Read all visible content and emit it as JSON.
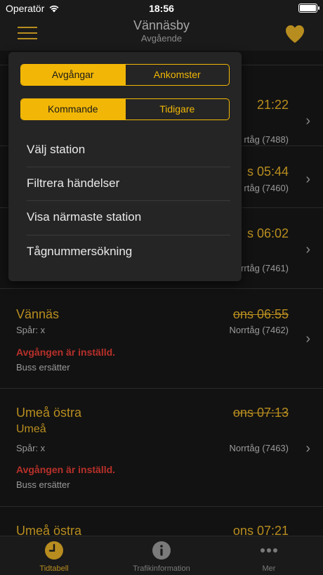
{
  "status_bar": {
    "carrier": "Operatör",
    "time": "18:56"
  },
  "nav": {
    "title": "Vännäsby",
    "subtitle": "Avgående"
  },
  "menu": {
    "seg1": [
      "Avgångar",
      "Ankomster"
    ],
    "seg2": [
      "Kommande",
      "Tidigare"
    ],
    "items": [
      "Välj station",
      "Filtrera händelser",
      "Visa närmaste station",
      "Tågnummersökning"
    ]
  },
  "list": {
    "row1": {
      "time": "21:22",
      "train": "rtåg (7488)"
    },
    "row2": {
      "time": "s 05:44",
      "train": "rtåg (7460)"
    },
    "row3": {
      "time": "s 06:02",
      "train": "rrtåg (7461)"
    },
    "row4": {
      "dest": "Vännäs",
      "time": "ons 06:55",
      "track": "Spår: x",
      "train": "Norrtåg (7462)",
      "cancel": "Avgången är inställd.",
      "bus": "Buss ersätter"
    },
    "row5": {
      "dest": "Umeå östra",
      "dest2": "Umeå",
      "time": "ons 07:13",
      "track": "Spår: x",
      "train": "Norrtåg (7463)",
      "cancel": "Avgången är inställd.",
      "bus": "Buss ersätter"
    },
    "row6": {
      "dest": "Umeå östra",
      "time": "ons 07:21"
    }
  },
  "tabs": [
    {
      "label": "Tidtabell",
      "icon": "clock-icon",
      "active": true
    },
    {
      "label": "Trafikinformation",
      "icon": "info-icon",
      "active": false
    },
    {
      "label": "Mer",
      "icon": "more-icon",
      "active": false
    }
  ],
  "colors": {
    "accent": "#f2b706",
    "muted_accent": "#b88d1f",
    "cancel": "#b8302a"
  }
}
